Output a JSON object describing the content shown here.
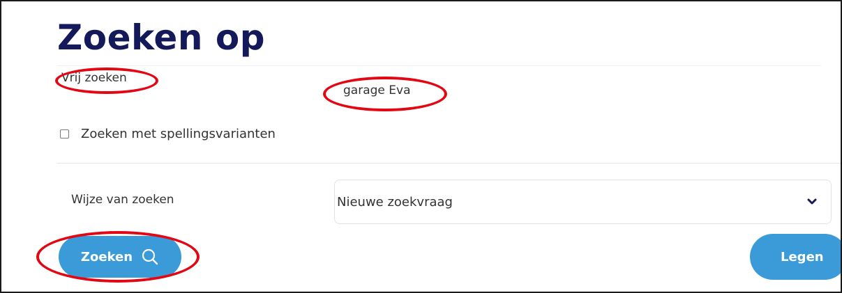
{
  "search_form": {
    "title": "Zoeken op",
    "free_search": {
      "label": "Vrij zoeken",
      "value": "garage Eva"
    },
    "spelling_variants": {
      "label": "Zoeken met spellingsvarianten",
      "checked": false
    },
    "search_mode": {
      "label": "Wijze van zoeken",
      "selected": "Nieuwe zoekvraag"
    },
    "buttons": {
      "search": "Zoeken",
      "clear": "Legen"
    }
  },
  "colors": {
    "title": "#14195a",
    "button": "#3a9bd8",
    "highlight": "#e30613"
  },
  "icons": [
    "search-icon",
    "chevron-down-icon"
  ]
}
